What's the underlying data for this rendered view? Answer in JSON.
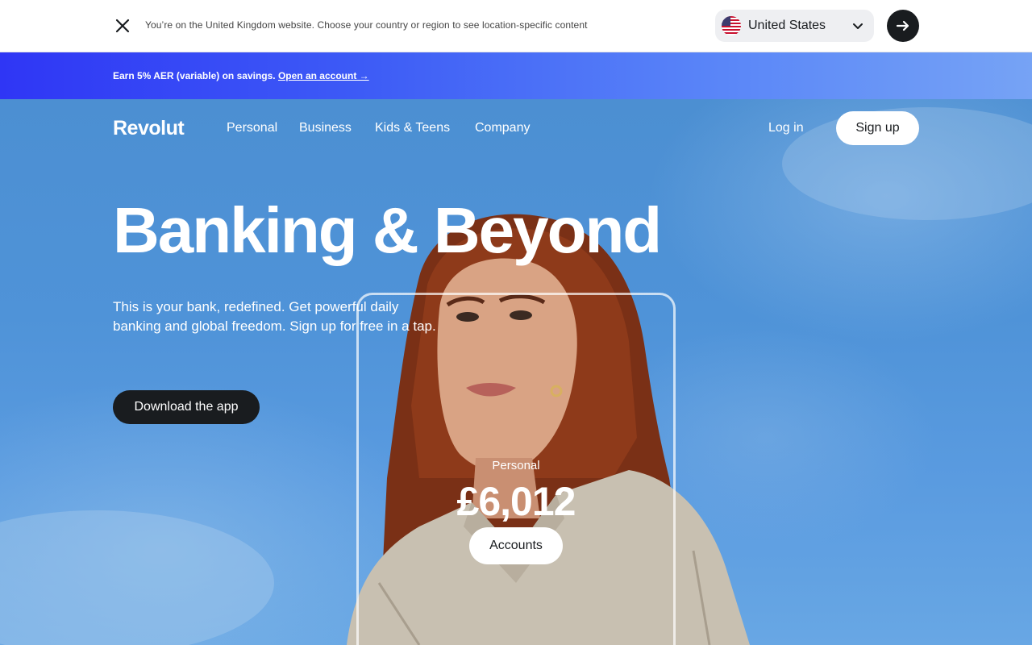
{
  "region_bar": {
    "message": "You’re on the United Kingdom website. Choose your country or region to see location-specific content",
    "selected_country": "United States",
    "close_icon": "close-icon",
    "go_icon": "arrow-right-icon"
  },
  "promo": {
    "text": "Earn 5% AER (variable) on savings. ",
    "link": "Open an account →"
  },
  "nav": {
    "logo": "Revolut",
    "items": [
      "Personal",
      "Business",
      "Kids & Teens",
      "Company"
    ],
    "login": "Log in",
    "signup": "Sign up"
  },
  "hero": {
    "headline": "Banking & Beyond",
    "subtext": "This is your bank, redefined. Get powerful daily banking and global freedom. Sign up for free in a tap.",
    "cta": "Download the app"
  },
  "card": {
    "label": "Personal",
    "amount": "£6,012",
    "button": "Accounts"
  },
  "colors": {
    "brand_dark": "#191c1f",
    "promo_start": "#2f36f5",
    "promo_end": "#76a3f5",
    "sky": "#4f93d8"
  }
}
